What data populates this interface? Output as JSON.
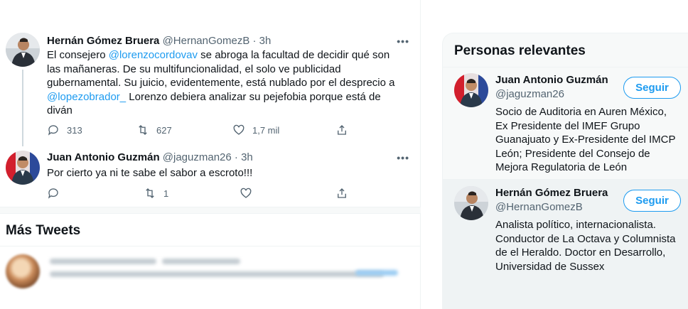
{
  "tweets": [
    {
      "name": "Hernán Gómez Bruera",
      "handle": "@HernanGomezB",
      "time": "· 3h",
      "text_parts": [
        {
          "t": "El consejero ",
          "mention": false
        },
        {
          "t": "@lorenzocordovav",
          "mention": true
        },
        {
          "t": " se abroga la facultad de decidir qué son las mañaneras. De su multifuncionalidad, el solo ve publicidad gubernamental. Su juicio, evidentemente, está nublado por el desprecio a ",
          "mention": false
        },
        {
          "t": "@lopezobrador_",
          "mention": true
        },
        {
          "t": " Lorenzo debiera analizar su pejefobia porque está de diván",
          "mention": false
        }
      ],
      "replies": "313",
      "retweets": "627",
      "likes": "1,7 mil"
    },
    {
      "name": "Juan Antonio Guzmán",
      "handle": "@jaguzman26",
      "time": "· 3h",
      "text": "Por cierto ya ni te sabe el sabor a escroto!!!",
      "replies": "",
      "retweets": "1",
      "likes": ""
    }
  ],
  "more_tweets_title": "Más Tweets",
  "sidebar": {
    "title": "Personas relevantes",
    "people": [
      {
        "name": "Juan Antonio Guzmán",
        "handle": "@jaguzman26",
        "follow_label": "Seguir",
        "bio": "Socio de Auditoria en Auren México, Ex Presidente del IMEF Grupo Guanajuato y Ex-Presidente del IMCP León; Presidente del Consejo de Mejora Regulatoria de León"
      },
      {
        "name": "Hernán Gómez Bruera",
        "handle": "@HernanGomezB",
        "follow_label": "Seguir",
        "bio": "Analista político, internacionalista. Conductor de La Octava y Columnista de el Heraldo. Doctor en Desarrollo, Universidad de Sussex"
      }
    ]
  },
  "icons": {
    "reply": "reply-icon",
    "retweet": "retweet-icon",
    "like": "heart-icon",
    "share": "share-icon",
    "more": "more-icon"
  },
  "colors": {
    "accent": "#1d9bf0",
    "text": "#0f1419",
    "secondary": "#536471"
  }
}
